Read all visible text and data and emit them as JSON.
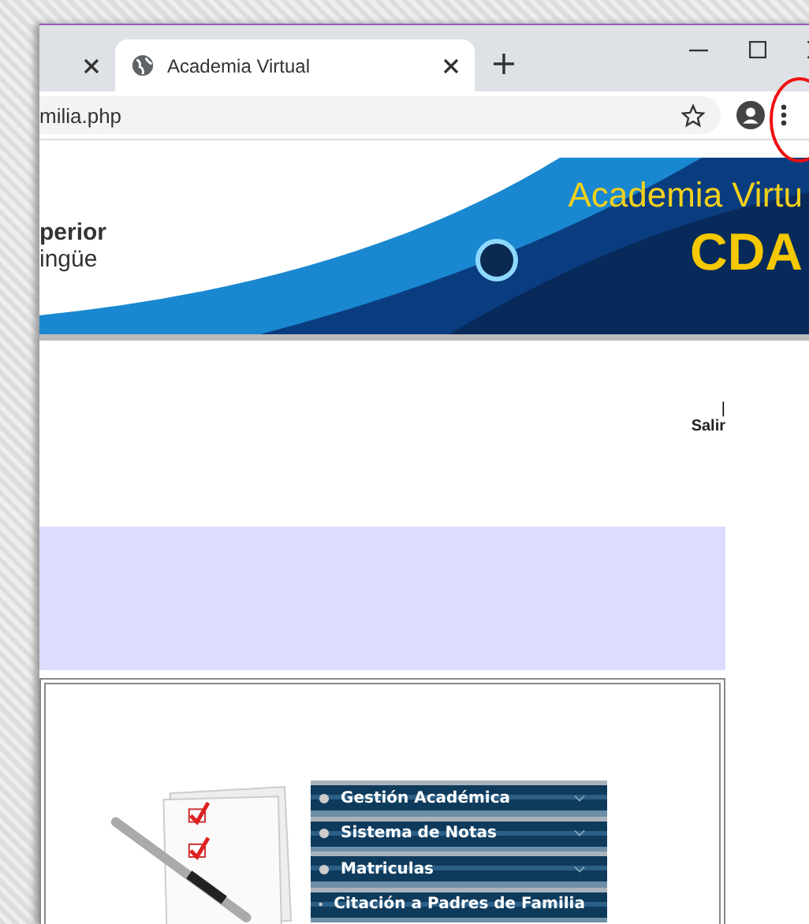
{
  "browser": {
    "tabs": [
      {
        "selected": false
      },
      {
        "title": "Academia Virtual",
        "selected": true
      }
    ],
    "address": "milia.php"
  },
  "banner": {
    "school_lines": [
      "perior",
      "ingüe"
    ],
    "title": "Academia Virtu",
    "acronym": "CDA"
  },
  "header_links": {
    "separator": "|",
    "logout": "Salir"
  },
  "menu": [
    {
      "label": "Gestión Académica",
      "expandable": true
    },
    {
      "label": "Sistema de Notas",
      "expandable": true
    },
    {
      "label": "Matriculas",
      "expandable": true
    },
    {
      "label": "Citación a Padres de Familia",
      "expandable": false
    }
  ]
}
